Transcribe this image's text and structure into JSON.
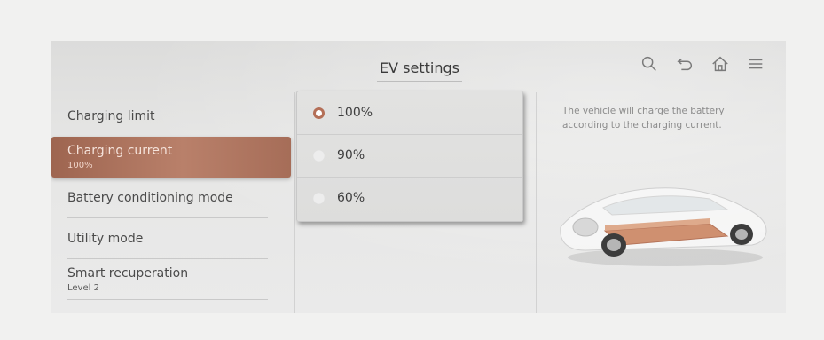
{
  "header": {
    "title": "EV settings"
  },
  "toolbar": {
    "icons": [
      "search-icon",
      "back-icon",
      "home-icon",
      "menu-icon"
    ]
  },
  "menu": {
    "items": [
      {
        "label": "Charging limit",
        "sub": ""
      },
      {
        "label": "Charging current",
        "sub": "100%"
      },
      {
        "label": "Battery conditioning mode",
        "sub": ""
      },
      {
        "label": "Utility mode",
        "sub": ""
      },
      {
        "label": "Smart recuperation",
        "sub": "Level 2"
      }
    ],
    "selected": "Charging current"
  },
  "options": {
    "items": [
      {
        "label": "100%",
        "selected": true
      },
      {
        "label": "90%",
        "selected": false
      },
      {
        "label": "60%",
        "selected": false
      }
    ]
  },
  "description": "The vehicle will charge the battery according to the charging current.",
  "colors": {
    "accent": "#b46f57",
    "background": "#e6e6e5"
  }
}
